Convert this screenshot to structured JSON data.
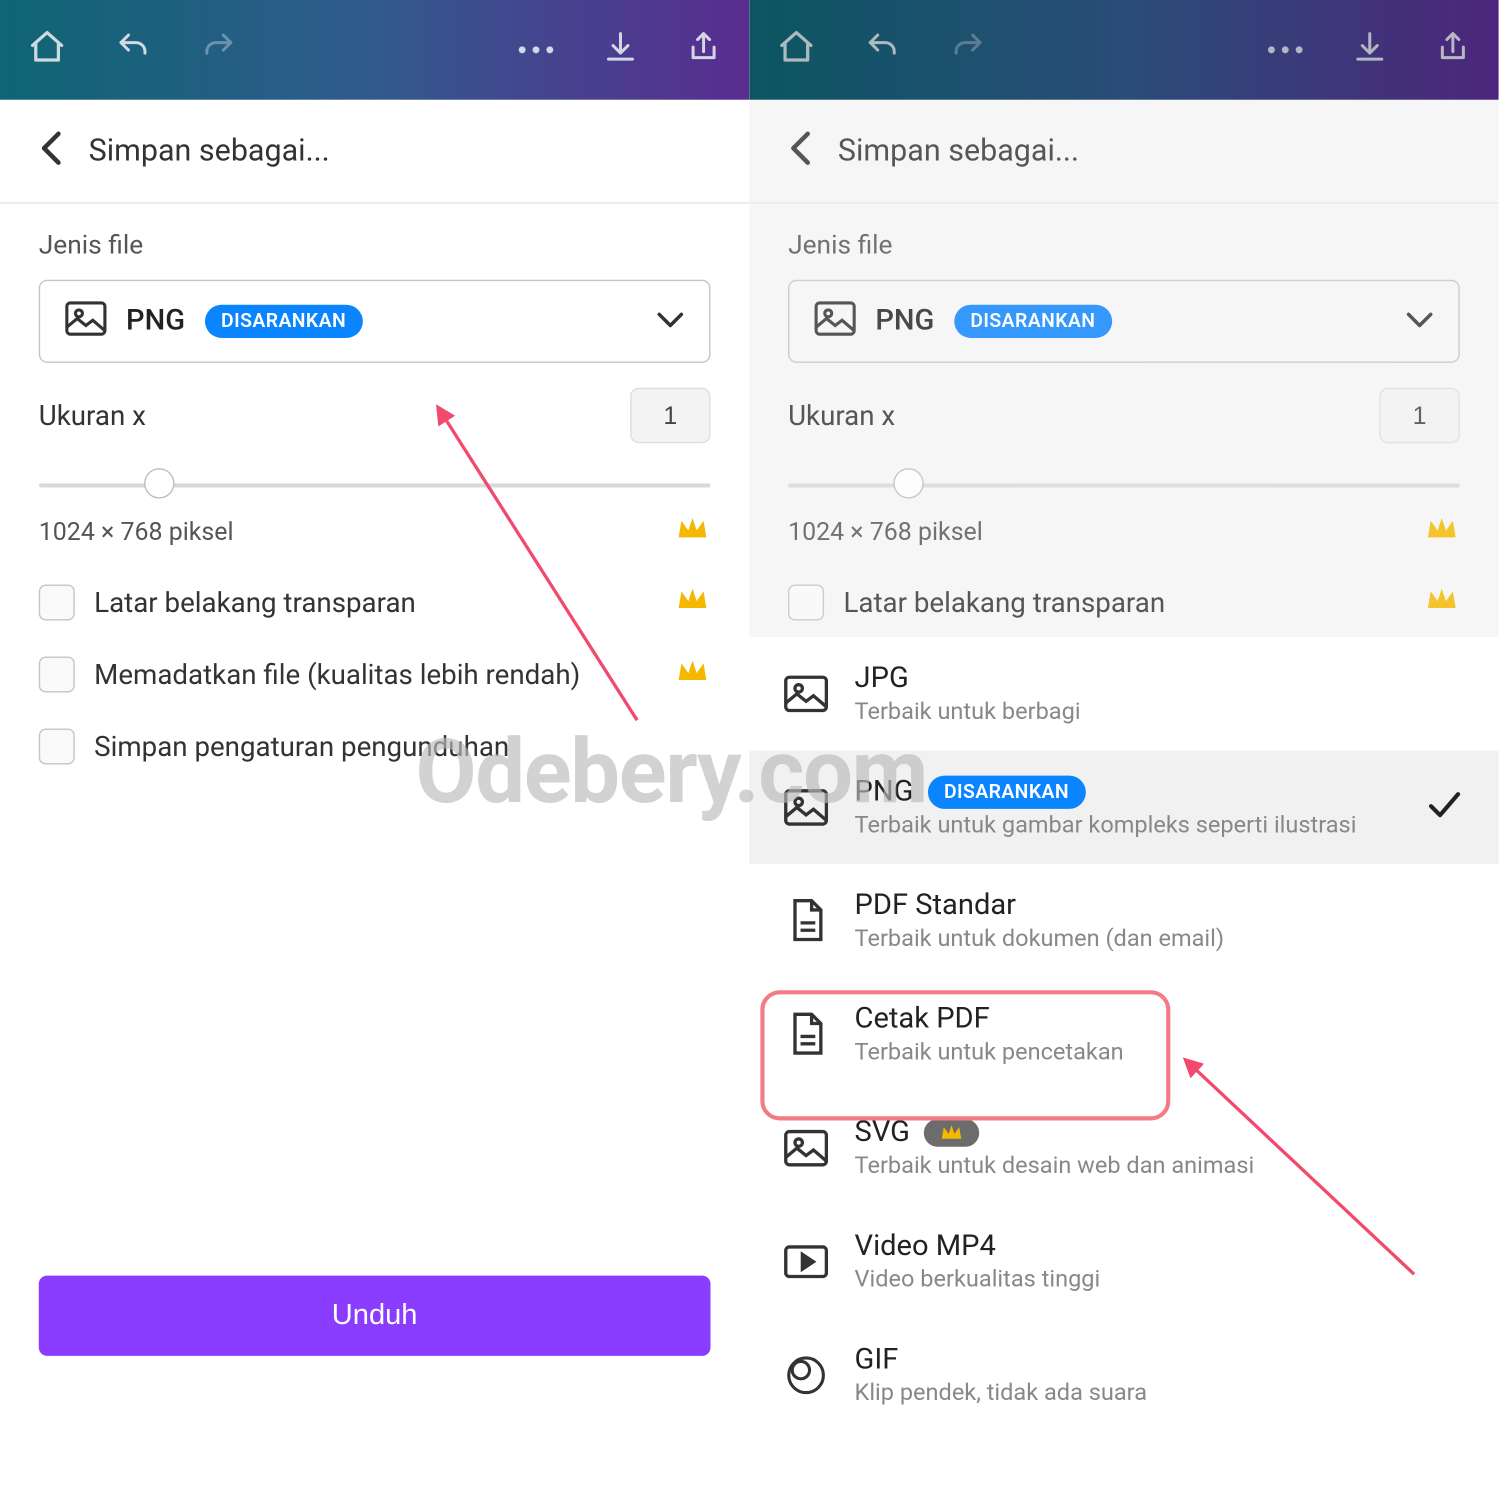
{
  "header": {
    "title": "Simpan sebagai..."
  },
  "left": {
    "file_type_label": "Jenis file",
    "selected_format": "PNG",
    "recommended_badge": "DISARANKAN",
    "size_label": "Ukuran x",
    "size_value": "1",
    "pixel_text": "1024 × 768 piksel",
    "checkbox_transparent": "Latar belakang transparan",
    "checkbox_compress": "Memadatkan file (kualitas lebih rendah)",
    "checkbox_save_settings": "Simpan pengaturan pengunduhan",
    "download_button": "Unduh"
  },
  "right": {
    "file_type_label": "Jenis file",
    "selected_format": "PNG",
    "recommended_badge": "DISARANKAN",
    "size_label": "Ukuran x",
    "size_value": "1",
    "pixel_text": "1024 × 768 piksel",
    "checkbox_transparent": "Latar belakang transparan",
    "options": [
      {
        "title": "JPG",
        "subtitle": "Terbaik untuk berbagi",
        "icon": "image",
        "selected": false
      },
      {
        "title": "PNG",
        "subtitle": "Terbaik untuk gambar kompleks seperti ilustrasi",
        "icon": "image",
        "selected": true,
        "badge": "DISARANKAN"
      },
      {
        "title": "PDF Standar",
        "subtitle": "Terbaik untuk dokumen (dan email)",
        "icon": "document",
        "selected": false
      },
      {
        "title": "Cetak PDF",
        "subtitle": "Terbaik untuk pencetakan",
        "icon": "document",
        "selected": false,
        "highlighted": true
      },
      {
        "title": "SVG",
        "subtitle": "Terbaik untuk desain web dan animasi",
        "icon": "image",
        "selected": false,
        "premium": true
      },
      {
        "title": "Video MP4",
        "subtitle": "Video berkualitas tinggi",
        "icon": "play",
        "selected": false
      },
      {
        "title": "GIF",
        "subtitle": "Klip pendek, tidak ada suara",
        "icon": "gif",
        "selected": false
      }
    ]
  },
  "watermark": "Odebery.com"
}
